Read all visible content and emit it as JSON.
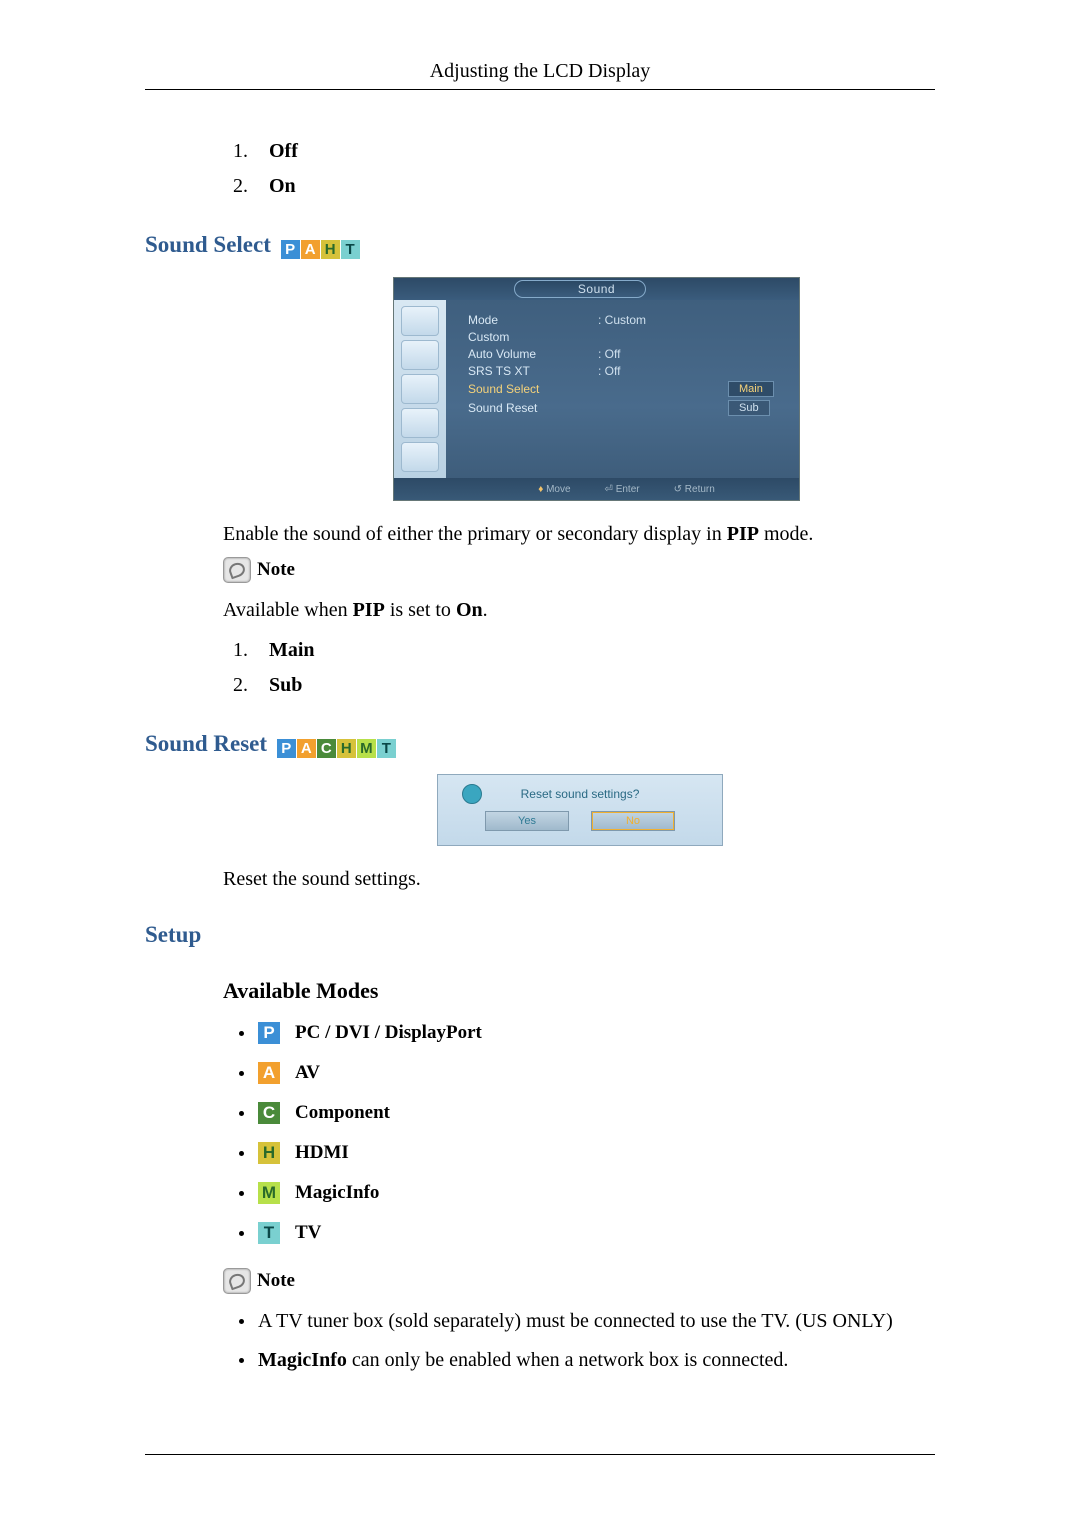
{
  "header": "Adjusting the LCD Display",
  "onoff_list": [
    "Off",
    "On"
  ],
  "sound_select": {
    "heading": "Sound Select",
    "modes": [
      "P",
      "A",
      "H",
      "T"
    ],
    "osd": {
      "title": "Sound",
      "items": [
        {
          "key": "Mode",
          "value": ": Custom"
        },
        {
          "key": "Custom",
          "value": ""
        },
        {
          "key": "Auto Volume",
          "value": ": Off"
        },
        {
          "key": "SRS TS XT",
          "value": ": Off"
        },
        {
          "key": "Sound Select",
          "value": "",
          "selected": true
        },
        {
          "key": "Sound Reset",
          "value": ""
        }
      ],
      "sub_options": {
        "selected": "Main",
        "other": "Sub"
      },
      "footer": {
        "move": "Move",
        "enter": "Enter",
        "return": "Return"
      }
    },
    "desc_pre": "Enable the sound of either the primary or secondary display in ",
    "desc_bold1": "PIP",
    "desc_post": " mode.",
    "note_label": "Note",
    "avail_pre": "Available when ",
    "avail_bold": "PIP",
    "avail_mid": " is set to ",
    "avail_bold2": "On",
    "avail_post": ".",
    "options": [
      "Main",
      "Sub"
    ]
  },
  "sound_reset": {
    "heading": "Sound Reset",
    "modes": [
      "P",
      "A",
      "C",
      "H",
      "M",
      "T"
    ],
    "dialog": {
      "question": "Reset sound settings?",
      "yes": "Yes",
      "no": "No"
    },
    "desc": "Reset the sound settings."
  },
  "setup": {
    "heading": "Setup",
    "subheading": "Available Modes",
    "modes": [
      {
        "code": "P",
        "label": "PC / DVI / DisplayPort"
      },
      {
        "code": "A",
        "label": "AV"
      },
      {
        "code": "C",
        "label": "Component"
      },
      {
        "code": "H",
        "label": "HDMI"
      },
      {
        "code": "M",
        "label": "MagicInfo"
      },
      {
        "code": "T",
        "label": "TV"
      }
    ],
    "note_label": "Note",
    "notes": {
      "n1": "A TV tuner box (sold separately) must be connected to use the TV. (US ONLY)",
      "n2_bold": "MagicInfo",
      "n2_rest": " can only be enabled when a network box is connected."
    }
  }
}
